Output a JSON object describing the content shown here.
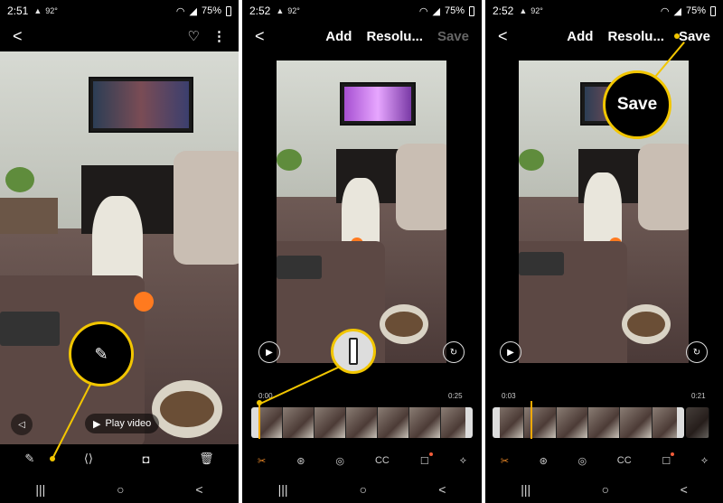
{
  "panels": [
    {
      "status": {
        "time": "2:51",
        "net": "92°",
        "battery": "75%"
      },
      "actions": {
        "back": "<",
        "favorite": "♡",
        "more": "⋮"
      },
      "mute_icon": "mute-icon",
      "play_video": {
        "icon": "▶",
        "label": "Play video"
      },
      "callout_icon": "pencil-icon",
      "bottom": {
        "edit": "✎",
        "share": "share",
        "instagram": "instagram",
        "delete": "trash"
      }
    },
    {
      "status": {
        "time": "2:52",
        "net": "92°",
        "battery": "75%"
      },
      "actions": {
        "back": "<",
        "add": "Add",
        "resolution": "Resolu...",
        "save": "Save"
      },
      "player": {
        "play": "▶",
        "rotate": "↻"
      },
      "timeline": {
        "start": "0:00",
        "end": "0:25"
      },
      "tools": [
        "✂",
        "⊛",
        "◎",
        "CC",
        "☐",
        "⟡"
      ]
    },
    {
      "status": {
        "time": "2:52",
        "net": "92°",
        "battery": "75%"
      },
      "actions": {
        "back": "<",
        "add": "Add",
        "resolution": "Resolu...",
        "save": "Save"
      },
      "player": {
        "play": "▶",
        "rotate": "↻"
      },
      "timeline": {
        "start": "0:03",
        "end": "0:21"
      },
      "callout": "Save",
      "tools": [
        "✂",
        "⊛",
        "◎",
        "CC",
        "☐",
        "⟡"
      ]
    }
  ],
  "navbar": {
    "recents": "|||",
    "home": "○",
    "back": "<"
  },
  "colors": {
    "accent": "#f2c600",
    "active_tool": "#f28c28"
  }
}
